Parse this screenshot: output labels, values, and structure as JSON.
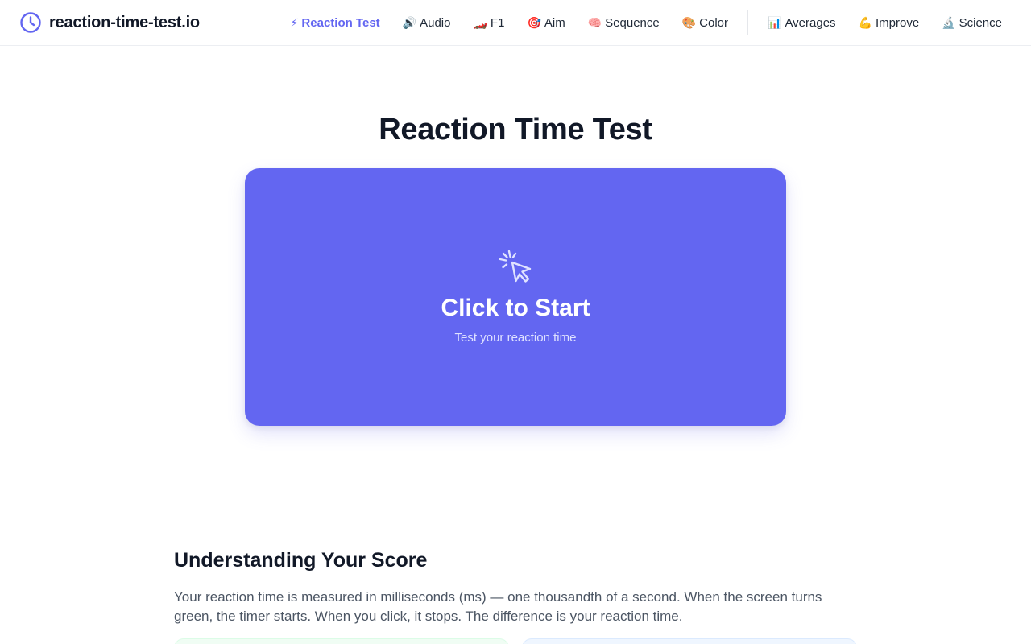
{
  "brand": {
    "name": "reaction-time-test.io",
    "icon": "clock-icon",
    "accent": "#6366f1"
  },
  "nav": {
    "primary": [
      {
        "emoji": "⚡",
        "label": "Reaction Test",
        "active": true
      },
      {
        "emoji": "🔊",
        "label": "Audio"
      },
      {
        "emoji": "🏎️",
        "label": "F1"
      },
      {
        "emoji": "🎯",
        "label": "Aim"
      },
      {
        "emoji": "🧠",
        "label": "Sequence"
      },
      {
        "emoji": "🎨",
        "label": "Color"
      }
    ],
    "secondary": [
      {
        "emoji": "📊",
        "label": "Averages"
      },
      {
        "emoji": "💪",
        "label": "Improve"
      },
      {
        "emoji": "🔬",
        "label": "Science"
      }
    ]
  },
  "hero": {
    "title": "Reaction Time Test"
  },
  "test_card": {
    "icon": "cursor-click-icon",
    "title": "Click to Start",
    "subtitle": "Test your reaction time",
    "color": "#6366f1"
  },
  "score_section": {
    "title": "Understanding Your Score",
    "body": "Your reaction time is measured in milliseconds (ms) — one thousandth of a second. When the screen turns green, the timer starts. When you click, it stops. The difference is your reaction time."
  },
  "colors": {
    "card_green_bg": "#f0fdf4",
    "card_blue_bg": "#eff6ff",
    "text_muted": "#4b5563"
  }
}
